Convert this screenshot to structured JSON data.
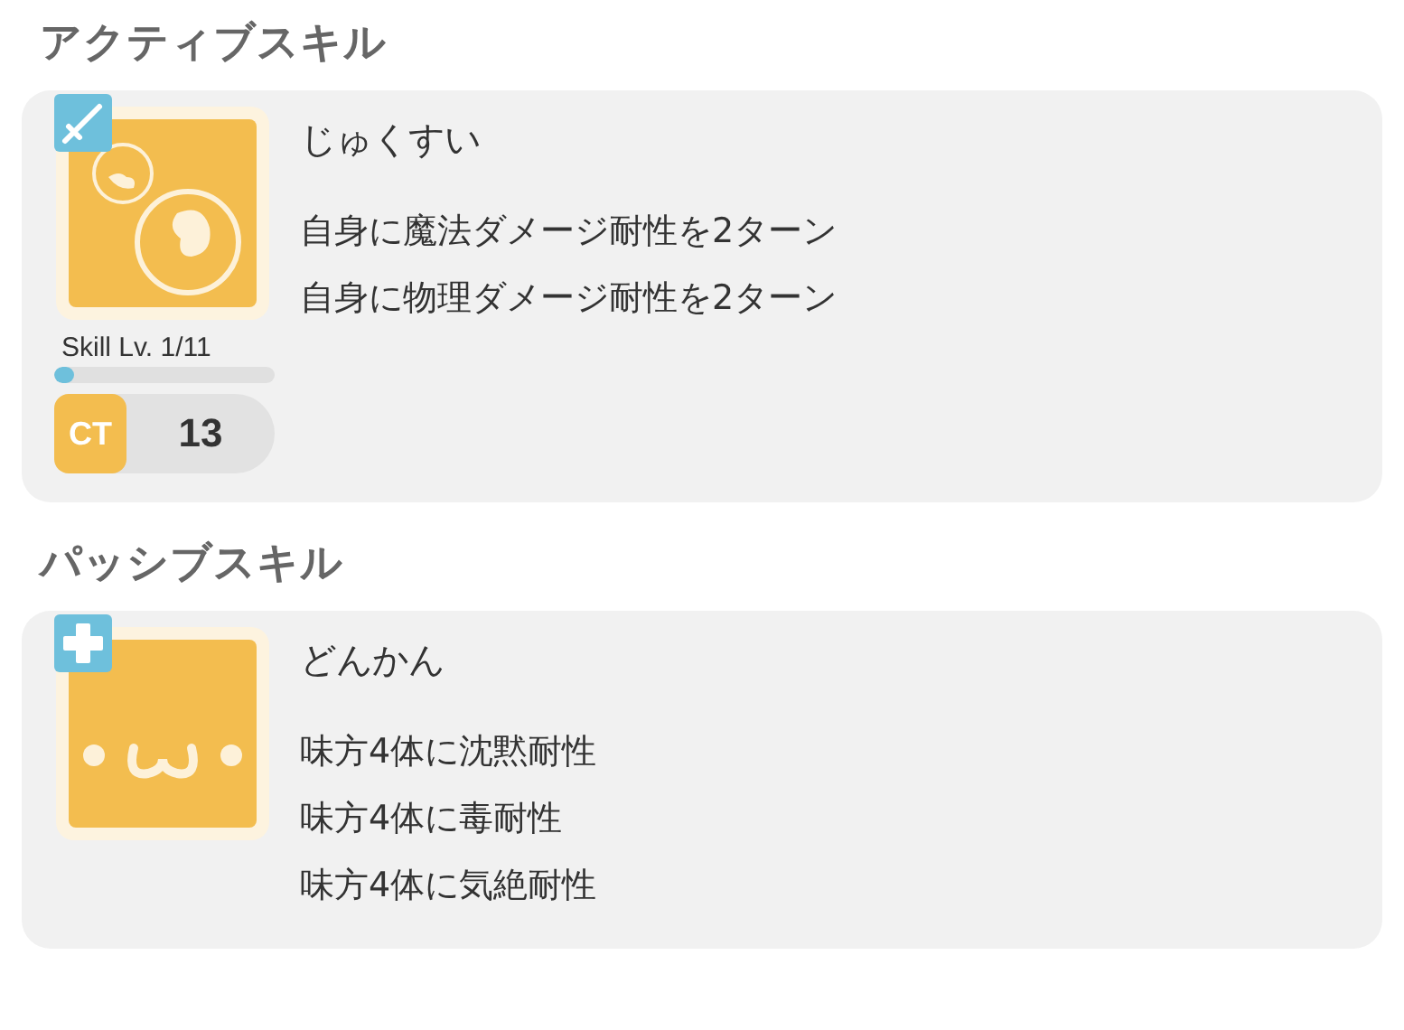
{
  "sections": [
    {
      "kind": "active",
      "heading": "アクティブスキル",
      "skill": {
        "badge": {
          "kind": "sword"
        },
        "art": {
          "kind": "bubble"
        },
        "name": "じゅくすい",
        "descriptions": [
          "自身に魔法ダメージ耐性を2ターン",
          "自身に物理ダメージ耐性を2ターン"
        ],
        "level_text": "Skill Lv. 1/11",
        "level": 0.09,
        "ct_label": "CT",
        "ct_value": "13"
      }
    },
    {
      "kind": "passive",
      "heading": "パッシブスキル",
      "skill": {
        "badge": {
          "kind": "plus"
        },
        "art": {
          "kind": "face"
        },
        "name": "どんかん",
        "descriptions": [
          "味方4体に沈黙耐性",
          "味方4体に毒耐性",
          "味方4体に気絶耐性"
        ]
      }
    }
  ]
}
